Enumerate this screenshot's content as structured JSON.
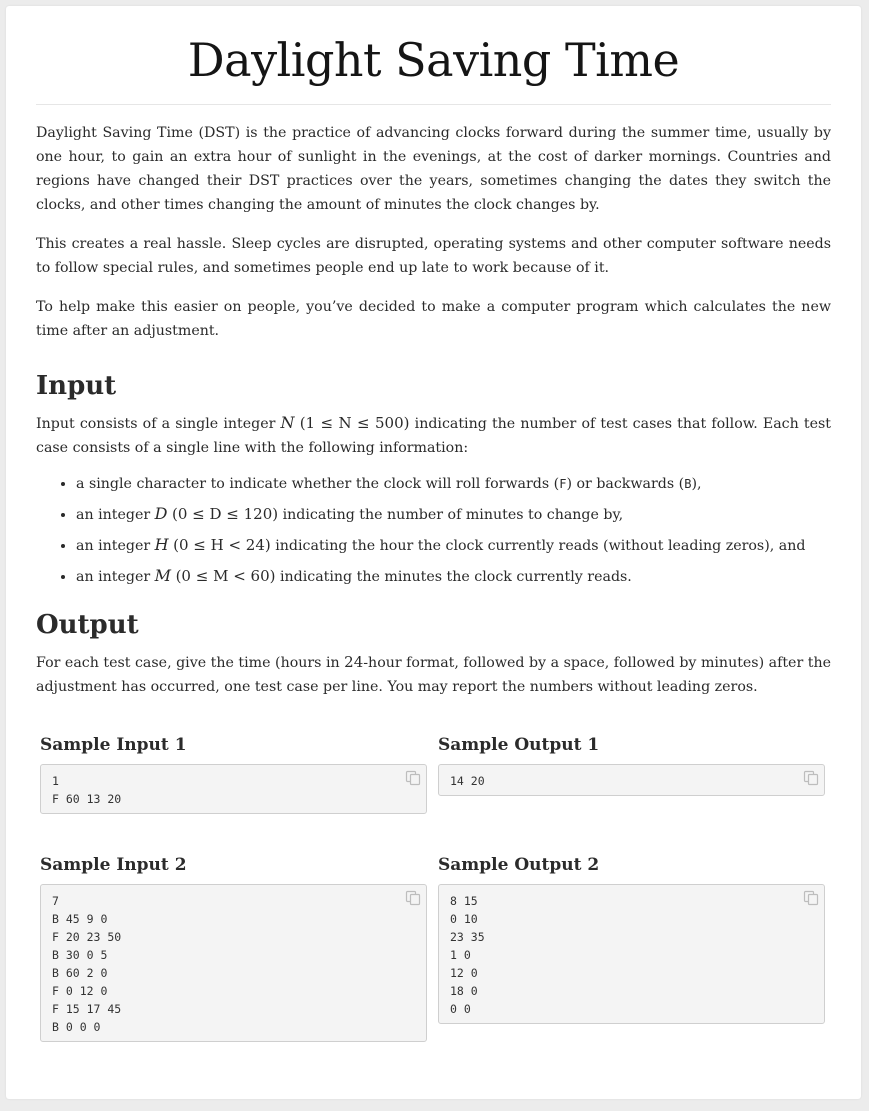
{
  "title": "Daylight Saving Time",
  "intro": {
    "p1": "Daylight Saving Time (DST) is the practice of advancing clocks forward during the summer time, usually by one hour, to gain an extra hour of sunlight in the evenings, at the cost of darker mornings. Countries and regions have changed their DST practices over the years, sometimes changing the dates they switch the clocks, and other times changing the amount of minutes the clock changes by.",
    "p2": "This creates a real hassle. Sleep cycles are disrupted, operating systems and other computer software needs to follow special rules, and sometimes people end up late to work because of it.",
    "p3": "To help make this easier on people, you’ve decided to make a computer program which calculates the new time after an adjustment."
  },
  "input_section": {
    "heading": "Input",
    "p_before": "Input consists of a single integer ",
    "p_math_var": "N",
    "p_math_range": "(1 ≤ N ≤ 500)",
    "p_after": " indicating the number of test cases that follow. Each test case consists of a single line with the following information:",
    "bullets": [
      {
        "pre": "a single character to indicate whether the clock will roll forwards (",
        "code1": "F",
        "mid": ") or backwards (",
        "code2": "B",
        "post": "),"
      },
      {
        "pre": "an integer ",
        "var": "D",
        "range": "(0 ≤ D ≤ 120)",
        "post": " indicating the number of minutes to change by,"
      },
      {
        "pre": "an integer ",
        "var": "H",
        "range": "(0 ≤ H < 24)",
        "post": " indicating the hour the clock currently reads (without leading zeros), and"
      },
      {
        "pre": "an integer ",
        "var": "M",
        "range": "(0 ≤ M < 60)",
        "post": " indicating the minutes the clock currently reads."
      }
    ]
  },
  "output_section": {
    "heading": "Output",
    "p_before": "For each test case, give the time (hours in ",
    "p_num": "24",
    "p_after": "-hour format, followed by a space, followed by minutes) after the adjustment has occurred, one test case per line. You may report the numbers without leading zeros."
  },
  "samples": [
    {
      "input_title": "Sample Input 1",
      "input": "1\nF 60 13 20",
      "output_title": "Sample Output 1",
      "output": "14 20"
    },
    {
      "input_title": "Sample Input 2",
      "input": "7\nB 45 9 0\nF 20 23 50\nB 30 0 5\nB 60 2 0\nF 0 12 0\nF 15 17 45\nB 0 0 0",
      "output_title": "Sample Output 2",
      "output": "8 15\n0 10\n23 35\n1 0\n12 0\n18 0\n0 0"
    }
  ],
  "icons": {
    "copy": "copy-icon"
  }
}
